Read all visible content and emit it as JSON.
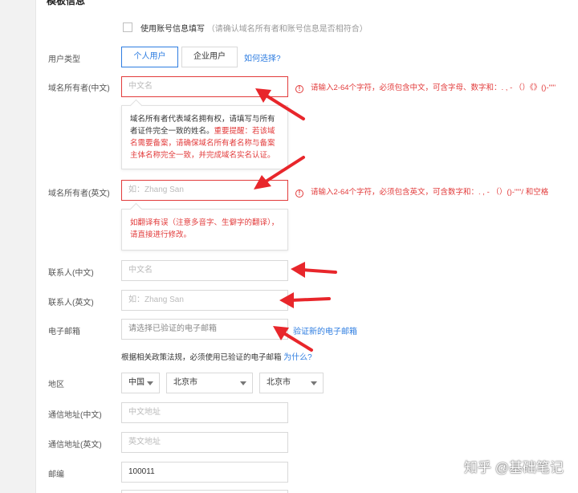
{
  "form": {
    "section_title": "模板信息",
    "use_account_info": {
      "label": "使用账号信息填写",
      "hint": "（请确认域名所有者和账号信息是否相符合）"
    },
    "user_type": {
      "label": "用户类型",
      "options": [
        "个人用户",
        "企业用户"
      ],
      "selected": "个人用户",
      "help_link": "如何选择?"
    },
    "owner_cn": {
      "label": "域名所有者(中文)",
      "placeholder": "中文名",
      "error": "请输入2-64个字符，必须包含中文，可含字母、数字和：.  ,  -  （）《》()-\"\"'",
      "tooltip_normal": "域名所有者代表域名拥有权，请填写与所有者证件完全一致的姓名。",
      "tooltip_warn": "重要提醒：若该域名需要备案，请确保域名所有者名称与备案主体名称完全一致，并完成域名实名认证。"
    },
    "owner_en": {
      "label": "域名所有者(英文)",
      "placeholder": "如：Zhang San",
      "error": "请输入2-64个字符，必须包含英文，可含数字和：.  ,  -  （）()-\"\"'/ 和空格",
      "tooltip_warn": "如翻译有误（注意多音字、生僻字的翻译），请直接进行修改。"
    },
    "contact_cn": {
      "label": "联系人(中文)",
      "placeholder": "中文名"
    },
    "contact_en": {
      "label": "联系人(英文)",
      "placeholder": "如：Zhang San"
    },
    "email": {
      "label": "电子邮箱",
      "placeholder": "请选择已验证的电子邮箱",
      "verify_link": "验证新的电子邮箱",
      "policy_note": "根据相关政策法规，必须使用已验证的电子邮箱",
      "why_link": "为什么?"
    },
    "region": {
      "label": "地区",
      "country": "中国",
      "province": "北京市",
      "city": "北京市"
    },
    "address_cn": {
      "label": "通信地址(中文)",
      "placeholder": "中文地址"
    },
    "address_en": {
      "label": "通信地址(英文)",
      "placeholder": "英文地址"
    },
    "postcode": {
      "label": "邮编",
      "value": "100011"
    }
  },
  "watermark": "知乎 @基础笔记",
  "colors": {
    "accent": "#2e7de1",
    "error": "#e23b3b",
    "annotation_arrow": "#e8262b"
  }
}
